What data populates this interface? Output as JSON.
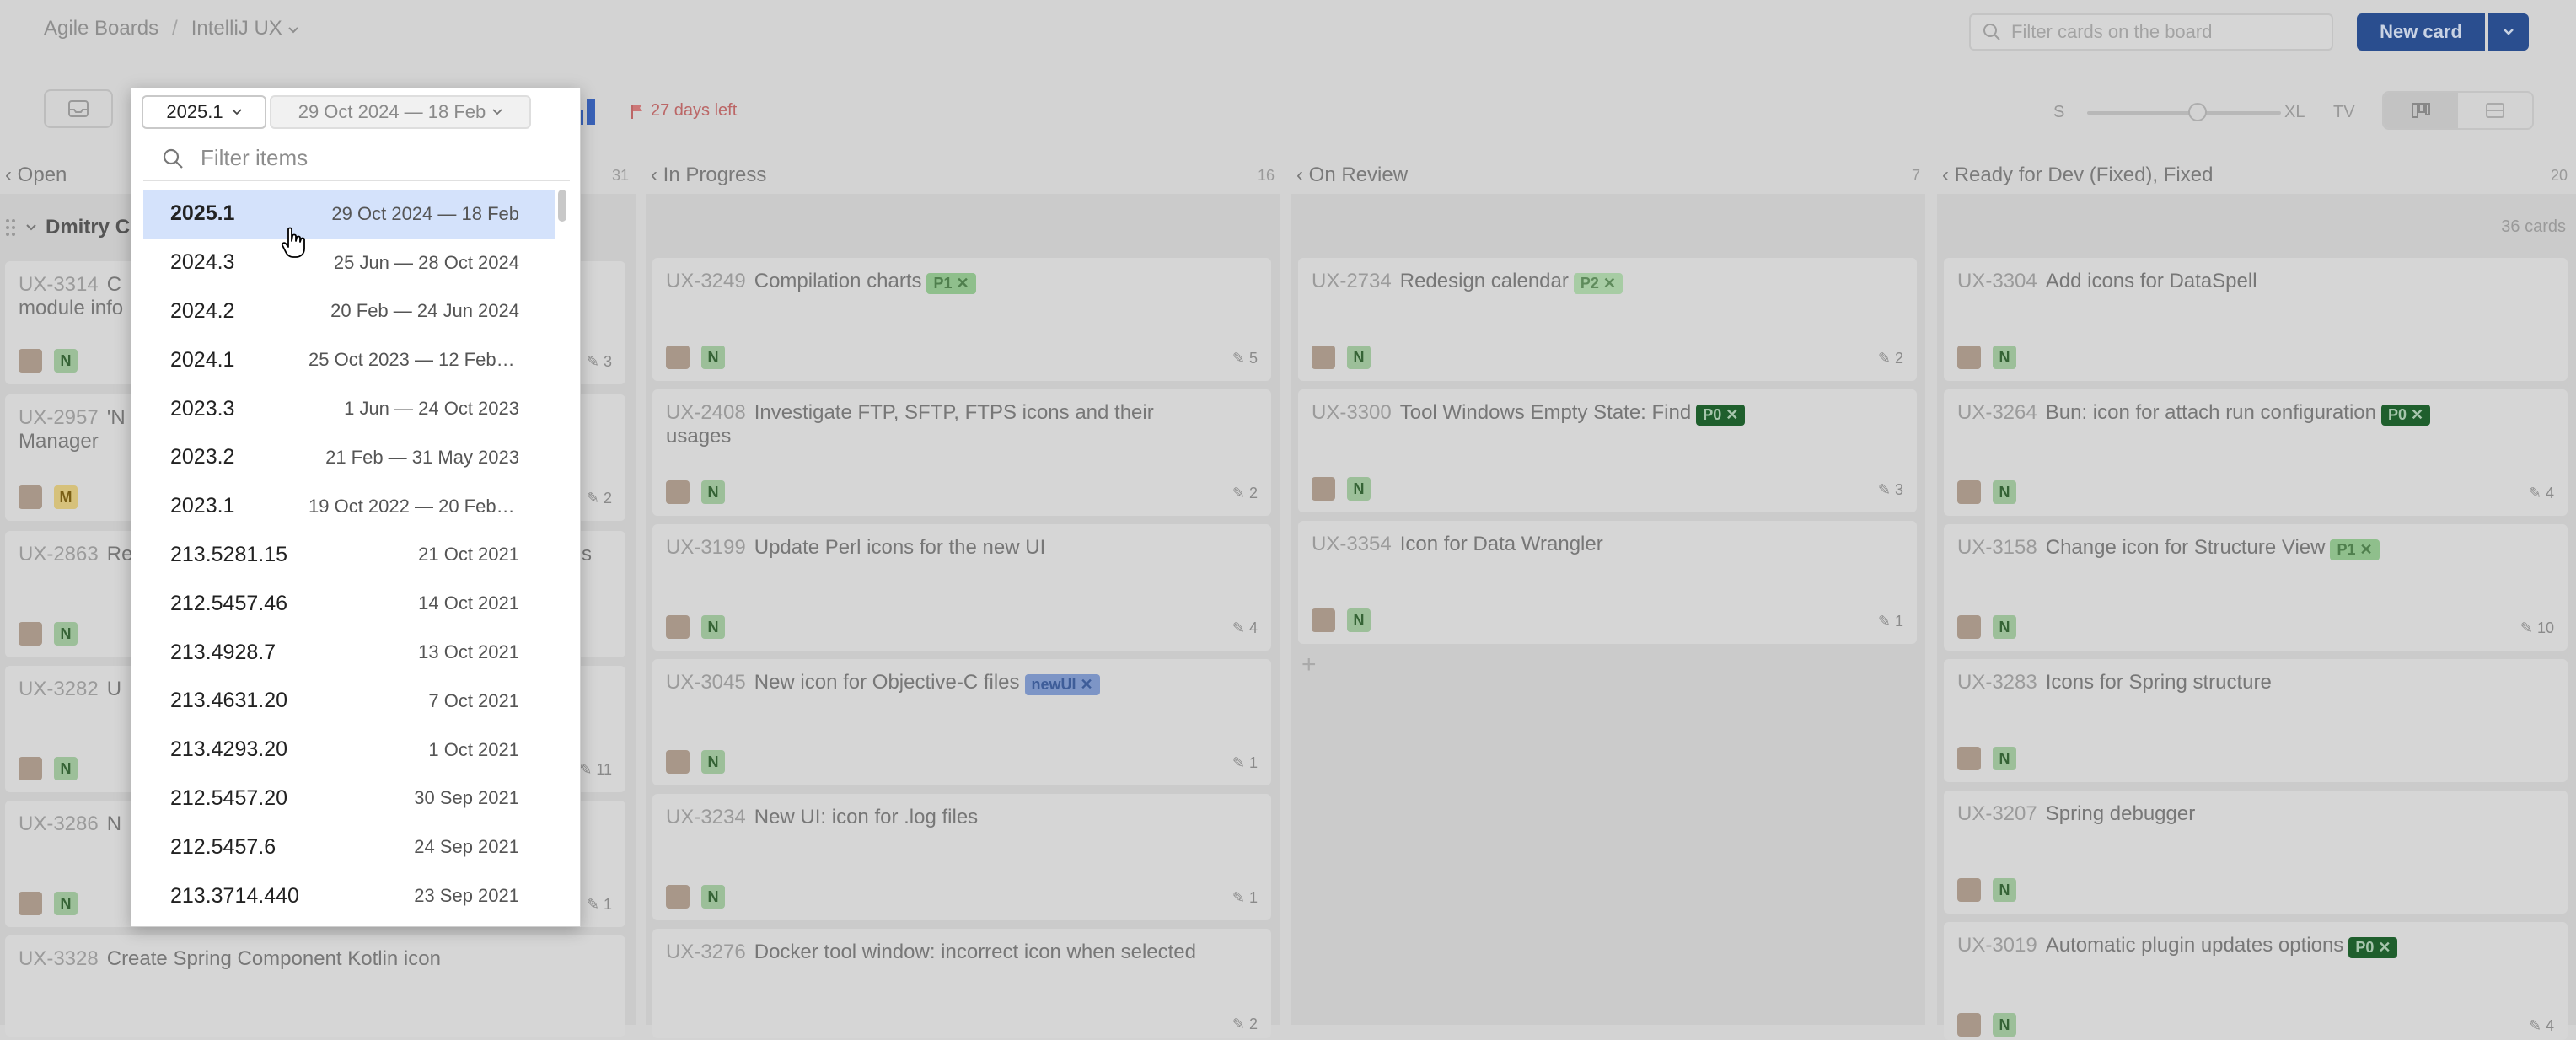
{
  "breadcrumb": {
    "board": "Agile Boards",
    "separator": "/",
    "project": "IntelliJ UX"
  },
  "search": {
    "placeholder": "Filter cards on the board"
  },
  "new_card": {
    "label": "New card"
  },
  "toolbar": {
    "days_left": "27 days left",
    "size_s": "S",
    "size_xl": "XL",
    "size_tv": "TV",
    "card_size_level": 0.5
  },
  "columns": [
    {
      "title": "Open",
      "count": "31"
    },
    {
      "title": "In Progress",
      "count": "16"
    },
    {
      "title": "On Review",
      "count": "7"
    },
    {
      "title": "Ready for Dev (Fixed), Fixed",
      "count": "20"
    }
  ],
  "swimlane": {
    "name": "Dmitry C",
    "cards_count": "36 cards"
  },
  "cards": {
    "col1": [
      {
        "id": "UX-3314",
        "title": "C",
        "title2": "module info",
        "att": "3"
      },
      {
        "id": "UX-2957",
        "title": "'N",
        "title2": "Manager",
        "att": "2"
      },
      {
        "id": "UX-2863",
        "title": "Re",
        "suffix": "s",
        "att": ""
      },
      {
        "id": "UX-3282",
        "title": "U",
        "att": "11"
      },
      {
        "id": "UX-3286",
        "title": "N",
        "att": "1"
      },
      {
        "id": "UX-3328",
        "title": "Create Spring Component Kotlin icon",
        "att": ""
      }
    ],
    "col2": [
      {
        "id": "UX-3249",
        "title": "Compilation charts",
        "tag": "P1",
        "att": "5"
      },
      {
        "id": "UX-2408",
        "title": "Investigate FTP, SFTP, FTPS icons and their",
        "title2": "usages",
        "att": "2"
      },
      {
        "id": "UX-3199",
        "title": "Update Perl icons for the new UI",
        "att": "4"
      },
      {
        "id": "UX-3045",
        "title": "New icon for Objective-C files",
        "tag": "newUI",
        "att": "1"
      },
      {
        "id": "UX-3234",
        "title": "New UI: icon for .log files",
        "att": "1"
      },
      {
        "id": "UX-3276",
        "title": "Docker tool window: incorrect icon when selected",
        "att": "2"
      }
    ],
    "col3": [
      {
        "id": "UX-2734",
        "title": "Redesign calendar",
        "tag": "P2",
        "att": "2"
      },
      {
        "id": "UX-3300",
        "title": "Tool Windows Empty State: Find",
        "tag": "P0",
        "att": "3"
      },
      {
        "id": "UX-3354",
        "title": "Icon for Data Wrangler",
        "att": "1"
      }
    ],
    "col4": [
      {
        "id": "UX-3304",
        "title": "Add icons for DataSpell",
        "att": ""
      },
      {
        "id": "UX-3264",
        "title": "Bun: icon for attach run configuration",
        "tag": "P0",
        "att": "4"
      },
      {
        "id": "UX-3158",
        "title": "Change icon for Structure View",
        "tag": "P1",
        "att": "10"
      },
      {
        "id": "UX-3283",
        "title": "Icons for Spring structure",
        "att": ""
      },
      {
        "id": "UX-3207",
        "title": "Spring debugger",
        "att": ""
      },
      {
        "id": "UX-3019",
        "title": "Automatic plugin updates options",
        "tag": "P0",
        "att": "4"
      }
    ]
  },
  "popup": {
    "version_value": "2025.1",
    "range_value": "29 Oct 2024 — 18 Feb",
    "filter_placeholder": "Filter items",
    "items": [
      {
        "name": "2025.1",
        "dates": "29 Oct 2024 — 18 Feb"
      },
      {
        "name": "2024.3",
        "dates": "25 Jun — 28 Oct 2024"
      },
      {
        "name": "2024.2",
        "dates": "20 Feb — 24 Jun 2024"
      },
      {
        "name": "2024.1",
        "dates": "25 Oct 2023 — 12 Feb 2…"
      },
      {
        "name": "2023.3",
        "dates": "1 Jun — 24 Oct 2023"
      },
      {
        "name": "2023.2",
        "dates": "21 Feb — 31 May 2023"
      },
      {
        "name": "2023.1",
        "dates": "19 Oct 2022 — 20 Feb …"
      },
      {
        "name": "213.5281.15",
        "dates": "21 Oct 2021"
      },
      {
        "name": "212.5457.46",
        "dates": "14 Oct 2021"
      },
      {
        "name": "213.4928.7",
        "dates": "13 Oct 2021"
      },
      {
        "name": "213.4631.20",
        "dates": "7 Oct 2021"
      },
      {
        "name": "213.4293.20",
        "dates": "1 Oct 2021"
      },
      {
        "name": "212.5457.20",
        "dates": "30 Sep 2021"
      },
      {
        "name": "212.5457.6",
        "dates": "24 Sep 2021"
      },
      {
        "name": "213.3714.440",
        "dates": "23 Sep 2021"
      }
    ]
  },
  "colors": {
    "accent": "#2a5bd7",
    "selected_row": "#d4e2fb",
    "overlay": "#d3d3d3"
  }
}
